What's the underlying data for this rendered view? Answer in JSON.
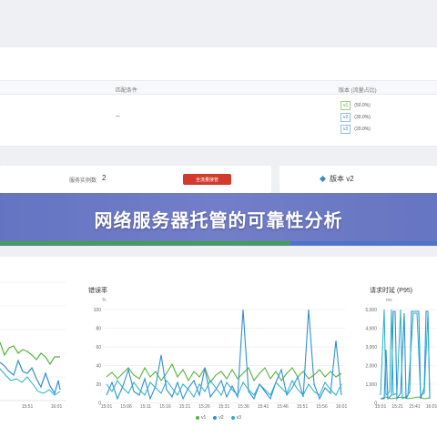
{
  "routing_table": {
    "col_match": "匹配条件",
    "col_version": "版本 (流量占比)",
    "match_value": "--",
    "versions": [
      {
        "tag": "v1",
        "pct": "(50.0%)",
        "color": "green"
      },
      {
        "tag": "v2",
        "pct": "(30.0%)",
        "color": "blue"
      },
      {
        "tag": "v3",
        "pct": "(20.0%)",
        "color": "blue"
      }
    ]
  },
  "service": {
    "instance_label": "服务实例数",
    "instance_count": "2",
    "takeover_button": "全流量接管",
    "version_label": "版本 v2"
  },
  "banner": {
    "title": "网络服务器托管的可靠性分析",
    "progress": 0.665
  },
  "charts": {
    "error_rate": {
      "title": "错误率",
      "unit": "%",
      "y_ticks": [
        "100",
        "80",
        "60",
        "40",
        "20",
        "0"
      ]
    },
    "latency": {
      "title": "请求时延 (P95)",
      "unit": "ms",
      "y_ticks": [
        "5,000",
        "4,000",
        "3,000",
        "2,000",
        "1,000",
        "0"
      ]
    },
    "left_x_ticks": [
      "15:51",
      "16:01"
    ],
    "x_ticks": [
      "15:01",
      "15:06",
      "15:11",
      "15:16",
      "15:21",
      "15:26",
      "15:31",
      "15:36",
      "15:41",
      "15:46",
      "15:51",
      "15:56",
      "16:01"
    ],
    "latency_x_ticks": [
      "15:01",
      "15:21",
      "15:41",
      "16:01"
    ],
    "legend": [
      {
        "name": "v1",
        "color": "#56b33e"
      },
      {
        "name": "v2",
        "color": "#2f8fd6"
      },
      {
        "name": "v3",
        "color": "#24b0c8"
      }
    ]
  },
  "colors": {
    "danger": "#d23a2e",
    "banner": "#6675c4",
    "v1": "#56b33e",
    "v2": "#2f8fd6",
    "v3": "#24b0c8"
  }
}
